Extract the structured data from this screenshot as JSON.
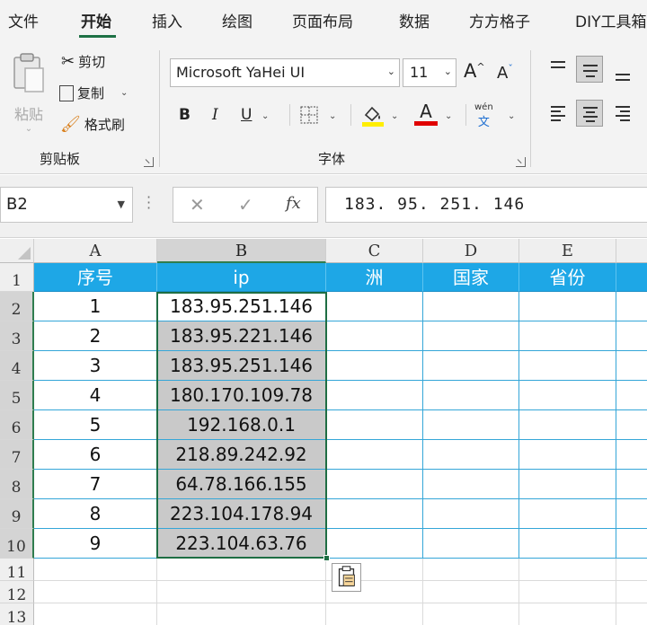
{
  "tabs": [
    "文件",
    "开始",
    "插入",
    "绘图",
    "页面布局",
    "数据",
    "方方格子",
    "DIY工具箱"
  ],
  "ribbon": {
    "paste_label": "粘贴",
    "cut_label": "剪切",
    "copy_label": "复制",
    "format_painter_label": "格式刷",
    "clipboard_group": "剪贴板",
    "font_name": "Microsoft YaHei UI",
    "font_size": "11",
    "font_group": "字体",
    "bold": "B",
    "italic": "I",
    "underline": "U",
    "font_color_letter": "A",
    "grow_font_letter": "A",
    "shrink_font_letter": "A",
    "wen_top": "wén",
    "wen_bottom": "文",
    "fill_color": "#ffee00",
    "font_color": "#e00000"
  },
  "formula_bar": {
    "name_box": "B2",
    "fx": "fx",
    "content": "183. 95. 251. 146"
  },
  "columns": [
    "A",
    "B",
    "C",
    "D",
    "E"
  ],
  "rows": [
    "1",
    "2",
    "3",
    "4",
    "5",
    "6",
    "7",
    "8",
    "9",
    "10",
    "11",
    "12",
    "13"
  ],
  "table": {
    "headers": [
      "序号",
      "ip",
      "洲",
      "国家",
      "省份"
    ],
    "rows": [
      [
        "1",
        "183.95.251.146"
      ],
      [
        "2",
        "183.95.221.146"
      ],
      [
        "3",
        "183.95.251.146"
      ],
      [
        "4",
        "180.170.109.78"
      ],
      [
        "5",
        "192.168.0.1"
      ],
      [
        "6",
        "218.89.242.92"
      ],
      [
        "7",
        "64.78.166.155"
      ],
      [
        "8",
        "223.104.178.94"
      ],
      [
        "9",
        "223.104.63.76"
      ]
    ]
  },
  "colors": {
    "header_fill": "#1ea7e6",
    "selection_border": "#1e6e43",
    "selected_fill": "#c9c9c9"
  }
}
